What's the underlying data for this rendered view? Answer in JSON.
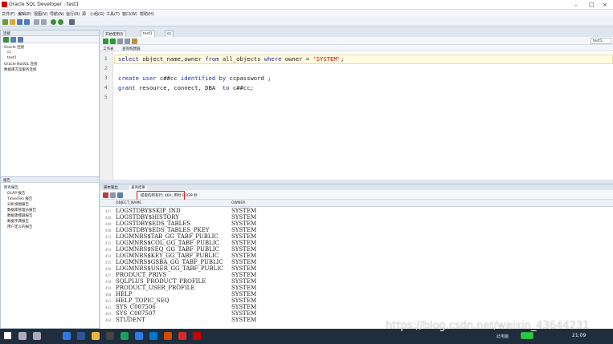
{
  "window": {
    "title": "Oracle SQL Developer : test1"
  },
  "menu": [
    "文件(F)",
    "编辑(E)",
    "视图(V)",
    "导航(N)",
    "运行(R)",
    "源",
    "小组(G)",
    "工具(T)",
    "窗口(W)",
    "帮助(H)"
  ],
  "connections_panel": {
    "title": "连接",
    "tree": [
      "Oracle 连接",
      "cc",
      "test1",
      "Oracle NoSQL 连接",
      "数据库方案服务连接"
    ]
  },
  "reports_panel": {
    "title": "报告",
    "tree": [
      "所有报告",
      "OLAP 报告",
      "TimesTen 报告",
      "分析视图报告",
      "数据库管理员报告",
      "数据建模器报告",
      "数据字典报告",
      "用户定义的报告"
    ]
  },
  "doc_tabs": [
    "开始使用页",
    "test1",
    "cc"
  ],
  "editor_subtabs": [
    "工作表",
    "查询构建器"
  ],
  "editor": {
    "line_numbers": [
      "1",
      "2",
      "3",
      "4",
      "5"
    ],
    "line1": {
      "kw1": "select",
      "t1": " object_name,owner ",
      "kw2": "from",
      "t2": " all_objects ",
      "kw3": "where",
      "t3": " owner = ",
      "str": "'SYSTEM'",
      "t4": ";"
    },
    "line3": {
      "kw1": "create user",
      "t1": " c##cc ",
      "kw2": "identified by",
      "t2": " ccpassword ;"
    },
    "line4": {
      "kw1": "grant",
      "t1": " resource, connect, DBA  ",
      "kw2": "to",
      "t2": " c##cc;"
    }
  },
  "output_tabs": [
    "脚本输出",
    "查询结果"
  ],
  "status": {
    "fetched": "提取的所有行: 464, 用时 0.039 秒"
  },
  "connection_label": "test1",
  "grid": {
    "headers": [
      "OBJECT_NAME",
      "OWNER"
    ],
    "rows": [
      {
        "n": "447",
        "name": "LOGSTDBY$SKIP_IND",
        "owner": "SYSTEM"
      },
      {
        "n": "448",
        "name": "LOGSTDBY$HISTORY",
        "owner": "SYSTEM"
      },
      {
        "n": "449",
        "name": "LOGSTDBY$EDS_TABLES",
        "owner": "SYSTEM"
      },
      {
        "n": "450",
        "name": "LOGSTDBY$EDS_TABLES_PKEY",
        "owner": "SYSTEM"
      },
      {
        "n": "451",
        "name": "LOGMNRS$TAB_GG_TABF_PUBLIC",
        "owner": "SYSTEM"
      },
      {
        "n": "452",
        "name": "LOGMNRS$COL_GG_TABF_PUBLIC",
        "owner": "SYSTEM"
      },
      {
        "n": "453",
        "name": "LOGMNRS$SEQ_GG_TABF_PUBLIC",
        "owner": "SYSTEM"
      },
      {
        "n": "454",
        "name": "LOGMNRS$KEY_GG_TABF_PUBLIC",
        "owner": "SYSTEM"
      },
      {
        "n": "455",
        "name": "LOGMNRS$GSBA_GG_TABF_PUBLIC",
        "owner": "SYSTEM"
      },
      {
        "n": "456",
        "name": "LOGMNRS$USER_GG_TABF_PUBLIC",
        "owner": "SYSTEM"
      },
      {
        "n": "457",
        "name": "PRODUCT_PRIVS",
        "owner": "SYSTEM"
      },
      {
        "n": "458",
        "name": "SQLPLUS_PRODUCT_PROFILE",
        "owner": "SYSTEM"
      },
      {
        "n": "459",
        "name": "PRODUCT_USER_PROFILE",
        "owner": "SYSTEM"
      },
      {
        "n": "460",
        "name": "HELP",
        "owner": "SYSTEM"
      },
      {
        "n": "461",
        "name": "HELP_TOPIC_SEQ",
        "owner": "SYSTEM"
      },
      {
        "n": "462",
        "name": "SYS_C007506",
        "owner": "SYSTEM"
      },
      {
        "n": "463",
        "name": "SYS_C007507",
        "owner": "SYSTEM"
      },
      {
        "n": "464",
        "name": "STUDENT",
        "owner": "SYSTEM"
      }
    ]
  },
  "taskbar": {
    "clock": "21:09",
    "watermark": "https://blog.csdn.net/weixin_43644231",
    "tray_label": "此电脑"
  },
  "colors": {
    "accent": "#1d2fa8",
    "string": "#c00000",
    "highlight_box": "#e02020"
  }
}
